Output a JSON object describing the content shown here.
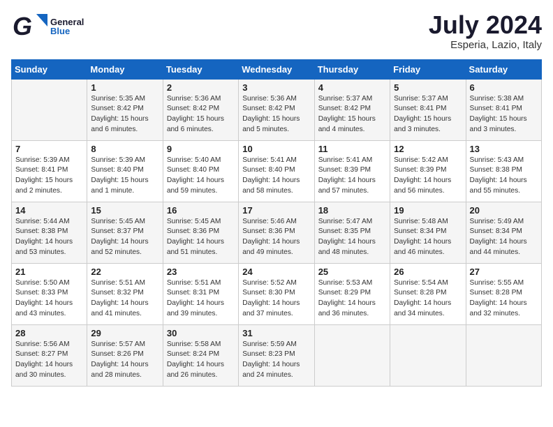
{
  "header": {
    "logo_general": "General",
    "logo_blue": "Blue",
    "month_year": "July 2024",
    "location": "Esperia, Lazio, Italy"
  },
  "weekdays": [
    "Sunday",
    "Monday",
    "Tuesday",
    "Wednesday",
    "Thursday",
    "Friday",
    "Saturday"
  ],
  "weeks": [
    [
      {
        "day": "",
        "sunrise": "",
        "sunset": "",
        "daylight": ""
      },
      {
        "day": "1",
        "sunrise": "Sunrise: 5:35 AM",
        "sunset": "Sunset: 8:42 PM",
        "daylight": "Daylight: 15 hours and 6 minutes."
      },
      {
        "day": "2",
        "sunrise": "Sunrise: 5:36 AM",
        "sunset": "Sunset: 8:42 PM",
        "daylight": "Daylight: 15 hours and 6 minutes."
      },
      {
        "day": "3",
        "sunrise": "Sunrise: 5:36 AM",
        "sunset": "Sunset: 8:42 PM",
        "daylight": "Daylight: 15 hours and 5 minutes."
      },
      {
        "day": "4",
        "sunrise": "Sunrise: 5:37 AM",
        "sunset": "Sunset: 8:42 PM",
        "daylight": "Daylight: 15 hours and 4 minutes."
      },
      {
        "day": "5",
        "sunrise": "Sunrise: 5:37 AM",
        "sunset": "Sunset: 8:41 PM",
        "daylight": "Daylight: 15 hours and 3 minutes."
      },
      {
        "day": "6",
        "sunrise": "Sunrise: 5:38 AM",
        "sunset": "Sunset: 8:41 PM",
        "daylight": "Daylight: 15 hours and 3 minutes."
      }
    ],
    [
      {
        "day": "7",
        "sunrise": "Sunrise: 5:39 AM",
        "sunset": "Sunset: 8:41 PM",
        "daylight": "Daylight: 15 hours and 2 minutes."
      },
      {
        "day": "8",
        "sunrise": "Sunrise: 5:39 AM",
        "sunset": "Sunset: 8:40 PM",
        "daylight": "Daylight: 15 hours and 1 minute."
      },
      {
        "day": "9",
        "sunrise": "Sunrise: 5:40 AM",
        "sunset": "Sunset: 8:40 PM",
        "daylight": "Daylight: 14 hours and 59 minutes."
      },
      {
        "day": "10",
        "sunrise": "Sunrise: 5:41 AM",
        "sunset": "Sunset: 8:40 PM",
        "daylight": "Daylight: 14 hours and 58 minutes."
      },
      {
        "day": "11",
        "sunrise": "Sunrise: 5:41 AM",
        "sunset": "Sunset: 8:39 PM",
        "daylight": "Daylight: 14 hours and 57 minutes."
      },
      {
        "day": "12",
        "sunrise": "Sunrise: 5:42 AM",
        "sunset": "Sunset: 8:39 PM",
        "daylight": "Daylight: 14 hours and 56 minutes."
      },
      {
        "day": "13",
        "sunrise": "Sunrise: 5:43 AM",
        "sunset": "Sunset: 8:38 PM",
        "daylight": "Daylight: 14 hours and 55 minutes."
      }
    ],
    [
      {
        "day": "14",
        "sunrise": "Sunrise: 5:44 AM",
        "sunset": "Sunset: 8:38 PM",
        "daylight": "Daylight: 14 hours and 53 minutes."
      },
      {
        "day": "15",
        "sunrise": "Sunrise: 5:45 AM",
        "sunset": "Sunset: 8:37 PM",
        "daylight": "Daylight: 14 hours and 52 minutes."
      },
      {
        "day": "16",
        "sunrise": "Sunrise: 5:45 AM",
        "sunset": "Sunset: 8:36 PM",
        "daylight": "Daylight: 14 hours and 51 minutes."
      },
      {
        "day": "17",
        "sunrise": "Sunrise: 5:46 AM",
        "sunset": "Sunset: 8:36 PM",
        "daylight": "Daylight: 14 hours and 49 minutes."
      },
      {
        "day": "18",
        "sunrise": "Sunrise: 5:47 AM",
        "sunset": "Sunset: 8:35 PM",
        "daylight": "Daylight: 14 hours and 48 minutes."
      },
      {
        "day": "19",
        "sunrise": "Sunrise: 5:48 AM",
        "sunset": "Sunset: 8:34 PM",
        "daylight": "Daylight: 14 hours and 46 minutes."
      },
      {
        "day": "20",
        "sunrise": "Sunrise: 5:49 AM",
        "sunset": "Sunset: 8:34 PM",
        "daylight": "Daylight: 14 hours and 44 minutes."
      }
    ],
    [
      {
        "day": "21",
        "sunrise": "Sunrise: 5:50 AM",
        "sunset": "Sunset: 8:33 PM",
        "daylight": "Daylight: 14 hours and 43 minutes."
      },
      {
        "day": "22",
        "sunrise": "Sunrise: 5:51 AM",
        "sunset": "Sunset: 8:32 PM",
        "daylight": "Daylight: 14 hours and 41 minutes."
      },
      {
        "day": "23",
        "sunrise": "Sunrise: 5:51 AM",
        "sunset": "Sunset: 8:31 PM",
        "daylight": "Daylight: 14 hours and 39 minutes."
      },
      {
        "day": "24",
        "sunrise": "Sunrise: 5:52 AM",
        "sunset": "Sunset: 8:30 PM",
        "daylight": "Daylight: 14 hours and 37 minutes."
      },
      {
        "day": "25",
        "sunrise": "Sunrise: 5:53 AM",
        "sunset": "Sunset: 8:29 PM",
        "daylight": "Daylight: 14 hours and 36 minutes."
      },
      {
        "day": "26",
        "sunrise": "Sunrise: 5:54 AM",
        "sunset": "Sunset: 8:28 PM",
        "daylight": "Daylight: 14 hours and 34 minutes."
      },
      {
        "day": "27",
        "sunrise": "Sunrise: 5:55 AM",
        "sunset": "Sunset: 8:28 PM",
        "daylight": "Daylight: 14 hours and 32 minutes."
      }
    ],
    [
      {
        "day": "28",
        "sunrise": "Sunrise: 5:56 AM",
        "sunset": "Sunset: 8:27 PM",
        "daylight": "Daylight: 14 hours and 30 minutes."
      },
      {
        "day": "29",
        "sunrise": "Sunrise: 5:57 AM",
        "sunset": "Sunset: 8:26 PM",
        "daylight": "Daylight: 14 hours and 28 minutes."
      },
      {
        "day": "30",
        "sunrise": "Sunrise: 5:58 AM",
        "sunset": "Sunset: 8:24 PM",
        "daylight": "Daylight: 14 hours and 26 minutes."
      },
      {
        "day": "31",
        "sunrise": "Sunrise: 5:59 AM",
        "sunset": "Sunset: 8:23 PM",
        "daylight": "Daylight: 14 hours and 24 minutes."
      },
      {
        "day": "",
        "sunrise": "",
        "sunset": "",
        "daylight": ""
      },
      {
        "day": "",
        "sunrise": "",
        "sunset": "",
        "daylight": ""
      },
      {
        "day": "",
        "sunrise": "",
        "sunset": "",
        "daylight": ""
      }
    ]
  ]
}
